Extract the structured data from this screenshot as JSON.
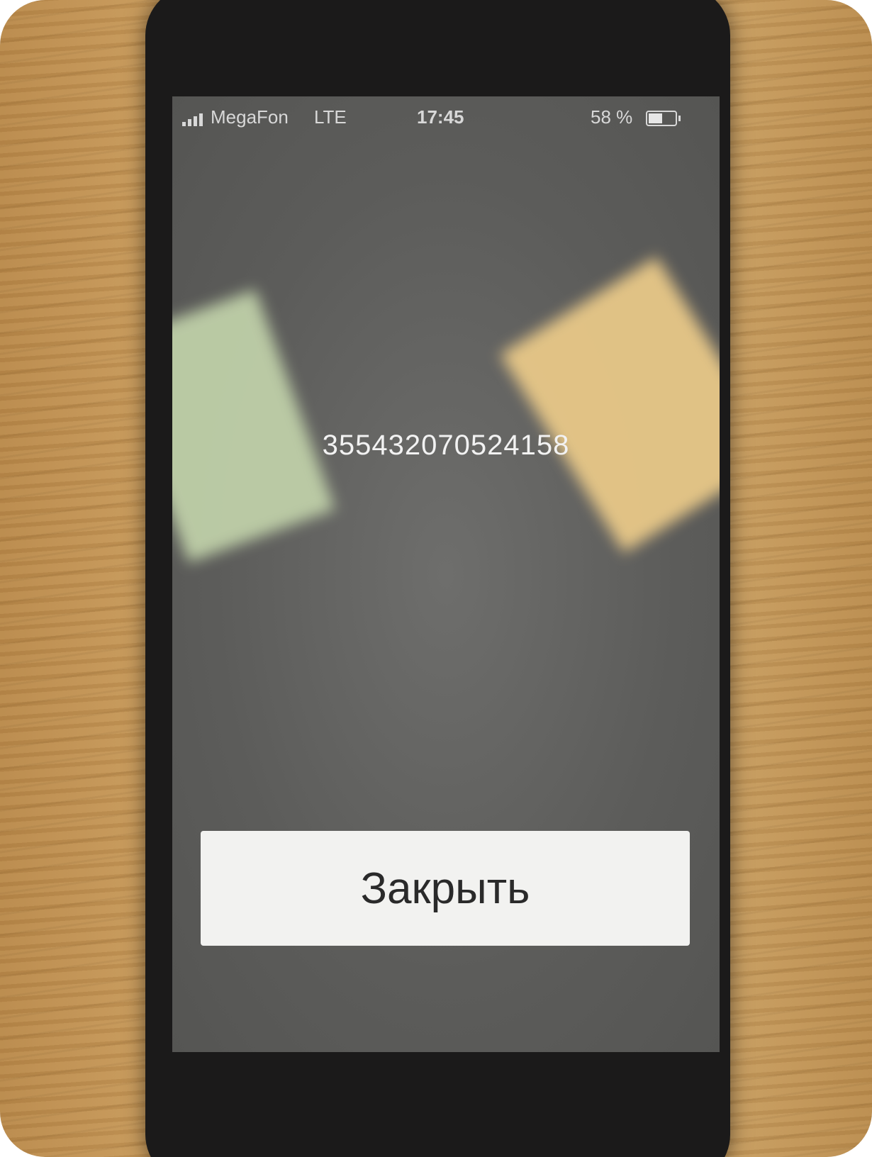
{
  "status_bar": {
    "carrier": "MegaFon",
    "network": "LTE",
    "time": "17:45",
    "battery_percent": "58 %",
    "battery_level": 0.58
  },
  "dialog": {
    "imei": "355432070524158",
    "close_label": "Закрыть"
  },
  "colors": {
    "screen_background": "#5c5c5a",
    "button_background": "#f2f2f0",
    "text_light": "#f2f2f2"
  }
}
